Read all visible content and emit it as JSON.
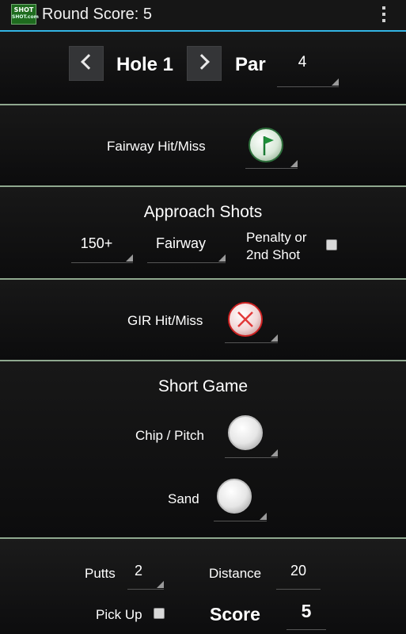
{
  "app": {
    "logo_line1": "SHOT",
    "logo_line2": "SHOT.com",
    "title": "Round Score:  5"
  },
  "hole": {
    "label": "Hole 1",
    "par_label": "Par",
    "par_value": "4"
  },
  "fairway": {
    "label": "Fairway Hit/Miss",
    "icon": "green-flag-icon"
  },
  "approach": {
    "heading": "Approach Shots",
    "distance": "150+",
    "lie": "Fairway",
    "penalty_line1": "Penalty or",
    "penalty_line2": "2nd Shot"
  },
  "gir": {
    "label": "GIR Hit/Miss",
    "icon": "red-x-icon"
  },
  "short_game": {
    "heading": "Short Game",
    "chip_label": "Chip / Pitch",
    "sand_label": "Sand"
  },
  "bottom": {
    "putts_label": "Putts",
    "putts_value": "2",
    "distance_label": "Distance",
    "distance_value": "20",
    "pickup_label": "Pick Up",
    "score_label": "Score",
    "score_value": "5"
  },
  "colors": {
    "accent": "#33b5e5",
    "divider": "#8fa88f",
    "gir_miss": "#e23a3a",
    "fairway_hit": "#1f8f3a"
  }
}
